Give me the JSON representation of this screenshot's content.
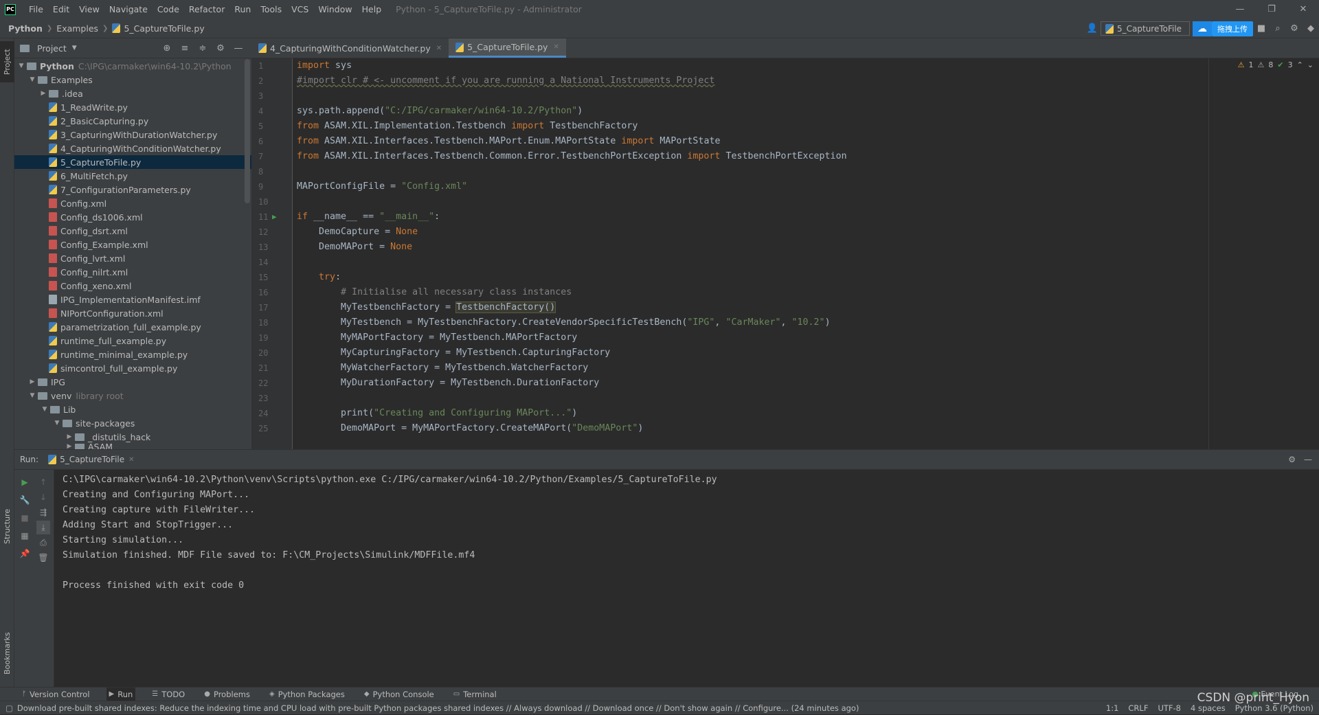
{
  "titlebar": {
    "logo": "PC",
    "menu": [
      "File",
      "Edit",
      "View",
      "Navigate",
      "Code",
      "Refactor",
      "Run",
      "Tools",
      "VCS",
      "Window",
      "Help"
    ],
    "title": "Python - 5_CaptureToFile.py - Administrator"
  },
  "navbar": {
    "crumbs": [
      "Python",
      "Examples",
      "5_CaptureToFile.py"
    ],
    "run_config": "5_CaptureToFile",
    "upload_label": "拖拽上传"
  },
  "left_stripe": {
    "project": "Project",
    "structure": "Structure",
    "bookmarks": "Bookmarks"
  },
  "project": {
    "title": "Project",
    "root": {
      "name": "Python",
      "path": "C:\\IPG\\carmaker\\win64-10.2\\Python"
    },
    "examples_folder": "Examples",
    "items": [
      {
        "name": ".idea",
        "type": "folder"
      },
      {
        "name": "1_ReadWrite.py",
        "type": "py"
      },
      {
        "name": "2_BasicCapturing.py",
        "type": "py"
      },
      {
        "name": "3_CapturingWithDurationWatcher.py",
        "type": "py"
      },
      {
        "name": "4_CapturingWithConditionWatcher.py",
        "type": "py"
      },
      {
        "name": "5_CaptureToFile.py",
        "type": "py"
      },
      {
        "name": "6_MultiFetch.py",
        "type": "py"
      },
      {
        "name": "7_ConfigurationParameters.py",
        "type": "py"
      },
      {
        "name": "Config.xml",
        "type": "xml"
      },
      {
        "name": "Config_ds1006.xml",
        "type": "xml"
      },
      {
        "name": "Config_dsrt.xml",
        "type": "xml"
      },
      {
        "name": "Config_Example.xml",
        "type": "xml"
      },
      {
        "name": "Config_lvrt.xml",
        "type": "xml"
      },
      {
        "name": "Config_nilrt.xml",
        "type": "xml"
      },
      {
        "name": "Config_xeno.xml",
        "type": "xml"
      },
      {
        "name": "IPG_ImplementationManifest.imf",
        "type": "imf"
      },
      {
        "name": "NIPortConfiguration.xml",
        "type": "xml"
      },
      {
        "name": "parametrization_full_example.py",
        "type": "py"
      },
      {
        "name": "runtime_full_example.py",
        "type": "py"
      },
      {
        "name": "runtime_minimal_example.py",
        "type": "py"
      },
      {
        "name": "simcontrol_full_example.py",
        "type": "py"
      }
    ],
    "ipg_folder": "IPG",
    "venv": {
      "name": "venv",
      "note": "library root"
    },
    "lib": "Lib",
    "site_packages": "site-packages",
    "distutils": "_distutils_hack",
    "asam": "ASAM"
  },
  "editor": {
    "tabs": [
      {
        "label": "4_CapturingWithConditionWatcher.py",
        "active": false
      },
      {
        "label": "5_CaptureToFile.py",
        "active": true
      }
    ],
    "inspections": {
      "warnings": "1",
      "weak": "8",
      "ok": "3"
    },
    "line_numbers": [
      "1",
      "2",
      "3",
      "4",
      "5",
      "6",
      "7",
      "8",
      "9",
      "10",
      "11",
      "12",
      "13",
      "14",
      "15",
      "16",
      "17",
      "18",
      "19",
      "20",
      "21",
      "22",
      "23",
      "24",
      "25"
    ]
  },
  "run": {
    "label": "Run:",
    "tab": "5_CaptureToFile",
    "output": [
      "C:\\IPG\\carmaker\\win64-10.2\\Python\\venv\\Scripts\\python.exe C:/IPG/carmaker/win64-10.2/Python/Examples/5_CaptureToFile.py",
      "Creating and Configuring MAPort...",
      "Creating capture with FileWriter...",
      "Adding Start and StopTrigger...",
      "Starting simulation...",
      "Simulation finished. MDF File saved to: F:\\CM_Projects\\Simulink/MDFFile.mf4",
      "",
      "Process finished with exit code 0"
    ]
  },
  "bottom_tabs": [
    "Version Control",
    "Run",
    "TODO",
    "Problems",
    "Python Packages",
    "Python Console",
    "Terminal"
  ],
  "event_log": "Event Log",
  "status": {
    "message": "Download pre-built shared indexes: Reduce the indexing time and CPU load with pre-built Python packages shared indexes // Always download // Download once // Don't show again // Configure... (24 minutes ago)",
    "position": "1:1",
    "line_sep": "CRLF",
    "encoding": "UTF-8",
    "indent": "4 spaces",
    "interpreter": "Python 3.6 (Python)"
  },
  "watermark": "CSDN @print_Hyon"
}
